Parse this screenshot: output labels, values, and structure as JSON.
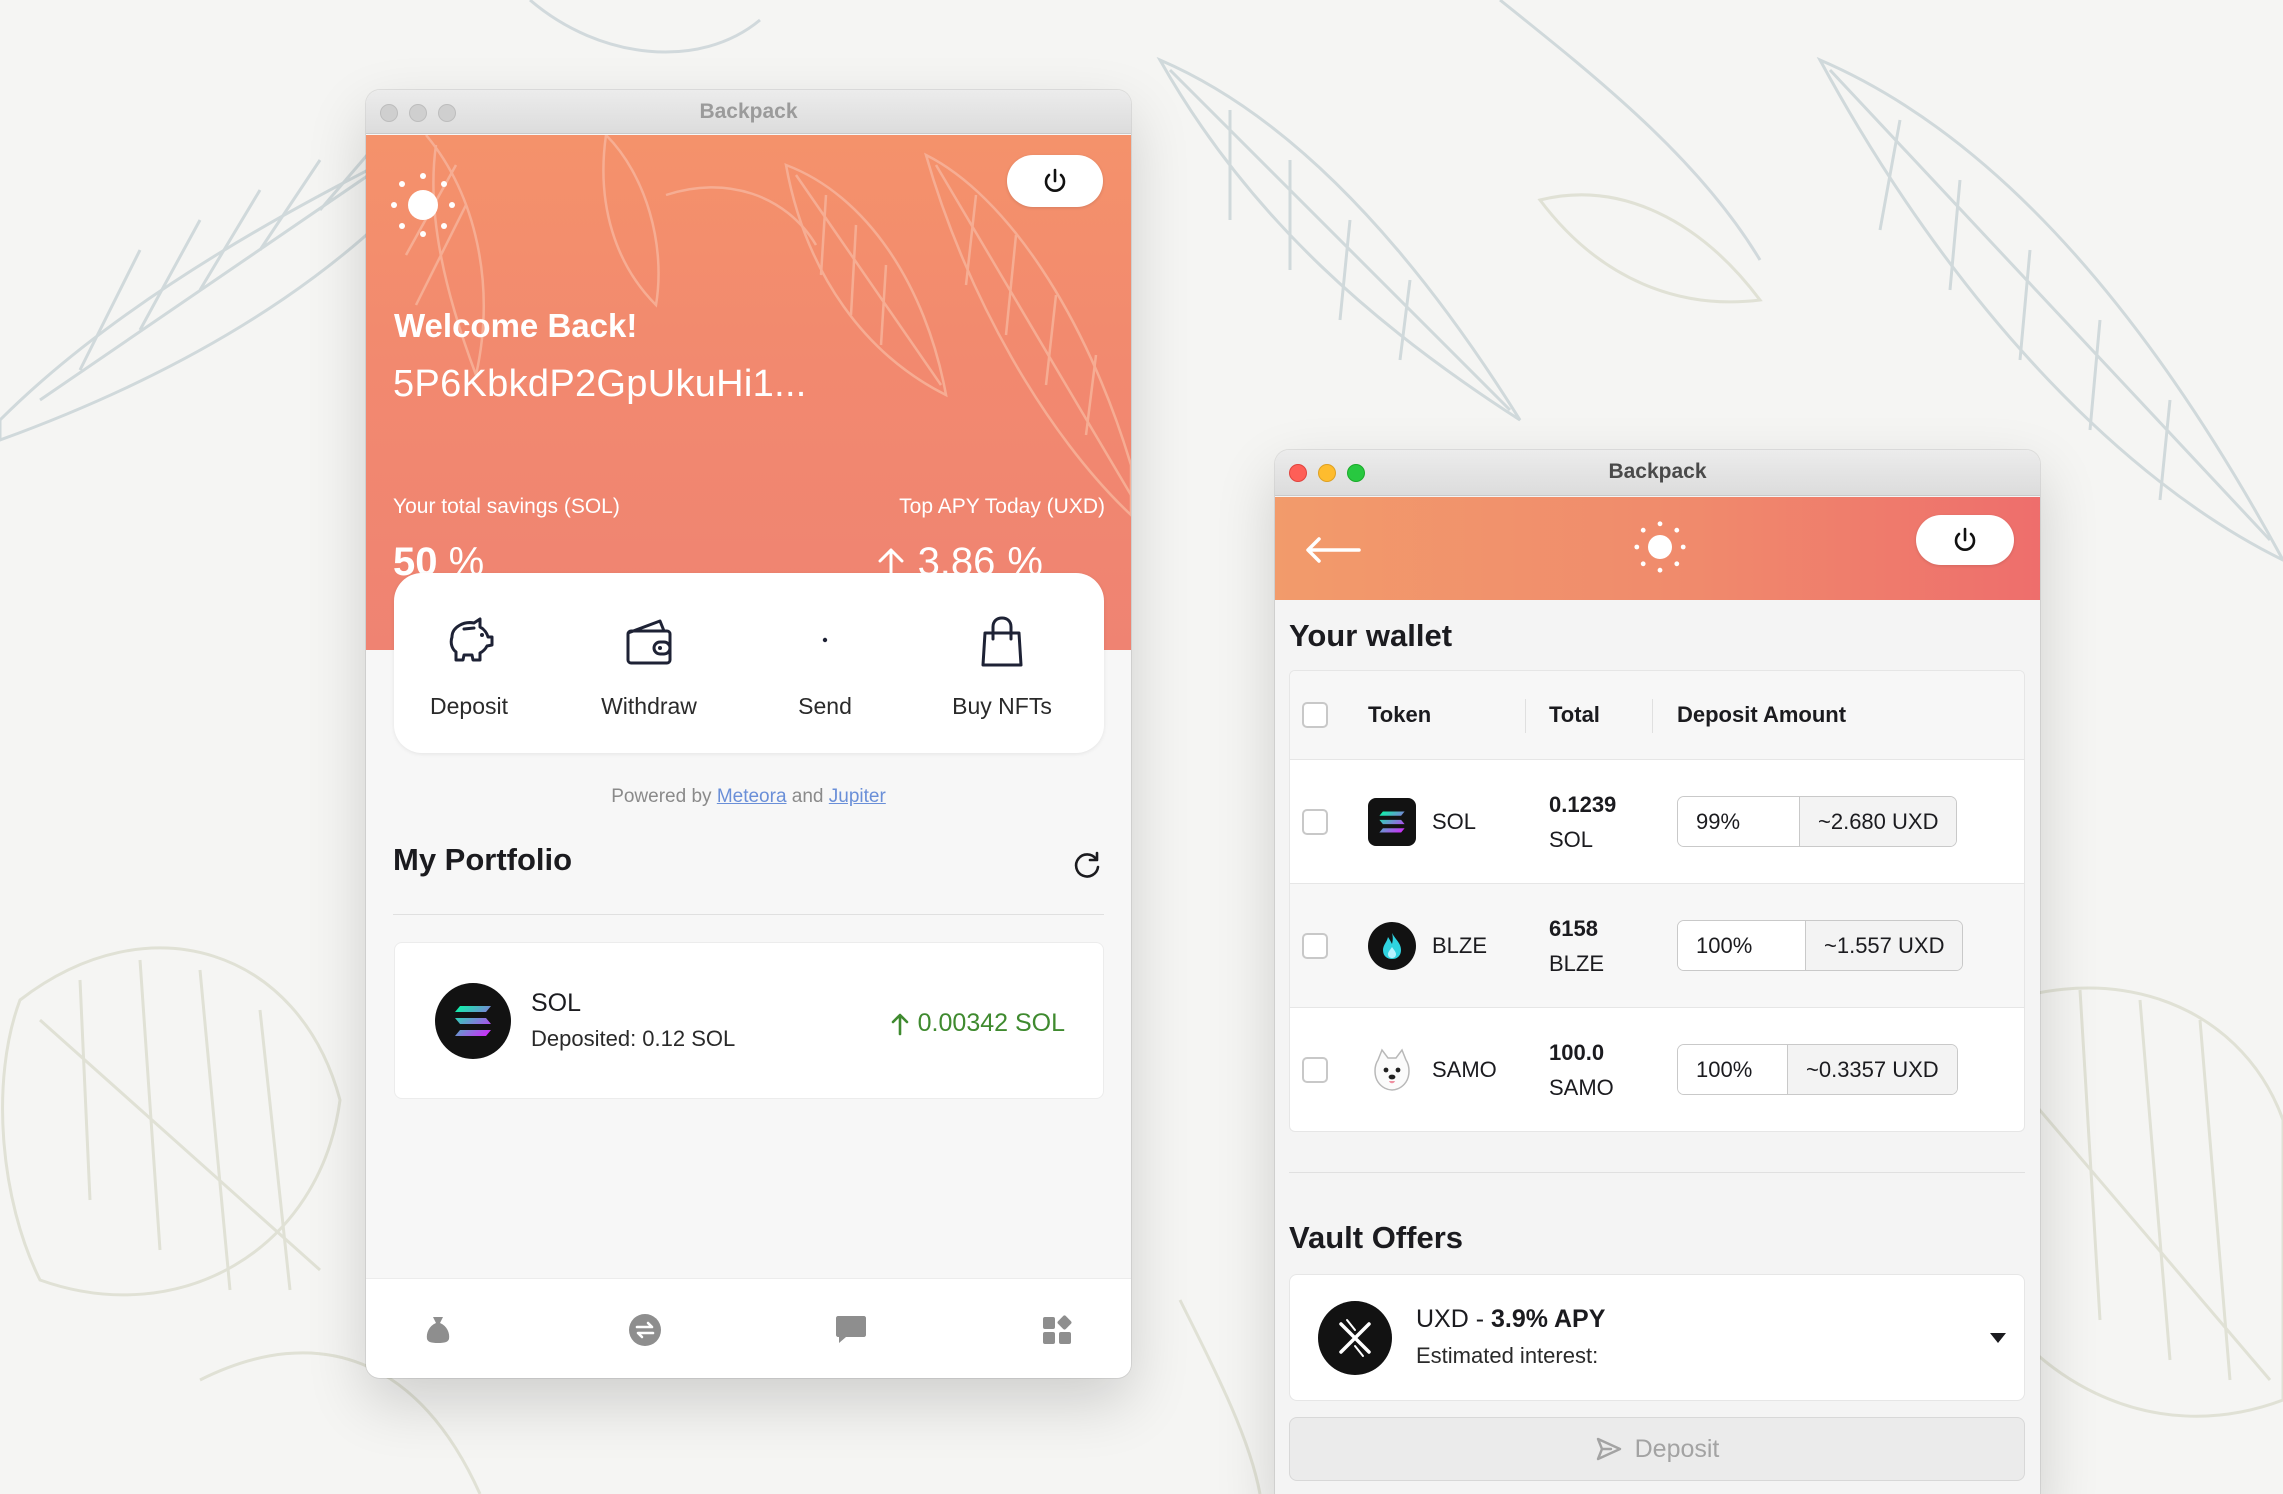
{
  "left_window": {
    "title": "Backpack",
    "welcome": "Welcome Back!",
    "address": "5P6KbkdP2GpUkuHi1...",
    "savings_label": "Your total savings (SOL)",
    "savings_value": "50",
    "savings_unit": "%",
    "apy_label": "Top APY Today (UXD)",
    "apy_value": "3.86",
    "apy_unit": "%",
    "actions": [
      {
        "label": "Deposit",
        "icon": "piggy-bank-icon"
      },
      {
        "label": "Withdraw",
        "icon": "wallet-icon"
      },
      {
        "label": "Send",
        "icon": "send-icon"
      },
      {
        "label": "Buy NFTs",
        "icon": "shopping-bag-icon"
      }
    ],
    "powered_prefix": "Powered by",
    "powered_link1": "Meteora",
    "powered_and": "and",
    "powered_link2": "Jupiter",
    "portfolio_title": "My Portfolio",
    "portfolio_items": [
      {
        "name": "SOL",
        "deposited": "Deposited: 0.12 SOL",
        "gain": "0.00342 SOL"
      }
    ],
    "tabs": [
      "pouch-icon",
      "swap-icon",
      "chat-icon",
      "apps-icon"
    ]
  },
  "right_window": {
    "title": "Backpack",
    "wallet_title": "Your wallet",
    "columns": {
      "token": "Token",
      "total": "Total",
      "deposit_amount": "Deposit Amount"
    },
    "rows": [
      {
        "token": "SOL",
        "total_amount": "0.1239",
        "total_unit": "SOL",
        "percent": "99%",
        "uxd": "~2.680 UXD"
      },
      {
        "token": "BLZE",
        "total_amount": "6158",
        "total_unit": "BLZE",
        "percent": "100%",
        "uxd": "~1.557 UXD"
      },
      {
        "token": "SAMO",
        "total_amount": "100.0",
        "total_unit": "SAMO",
        "percent": "100%",
        "uxd": "~0.3357 UXD"
      }
    ],
    "vault_title": "Vault Offers",
    "vault": {
      "name": "UXD - ",
      "apy": "3.9% APY",
      "estimated": "Estimated interest:"
    },
    "deposit_button": "Deposit"
  },
  "colors": {
    "hero_orange": "#f2896f",
    "header_gradient_start": "#f29b6b",
    "header_gradient_end": "#ee6e6c",
    "gain_green": "#3f8a2f",
    "link_blue": "#6a8fd8"
  }
}
